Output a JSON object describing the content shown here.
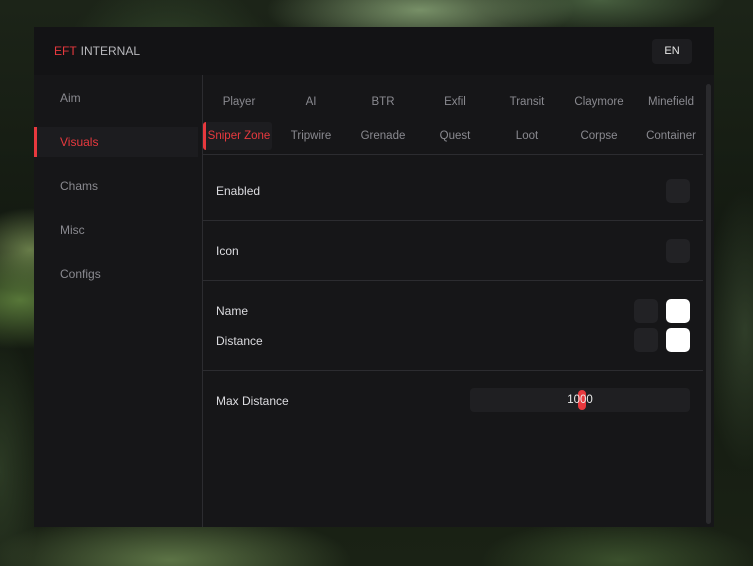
{
  "header": {
    "brand": "EFT",
    "title": "INTERNAL",
    "language": "EN"
  },
  "sidebar": {
    "items": [
      {
        "label": "Aim"
      },
      {
        "label": "Visuals"
      },
      {
        "label": "Chams"
      },
      {
        "label": "Misc"
      },
      {
        "label": "Configs"
      }
    ],
    "active": "Visuals"
  },
  "tabs": {
    "row1": [
      "Player",
      "AI",
      "BTR",
      "Exfil",
      "Transit",
      "Claymore",
      "Minefield"
    ],
    "row2": [
      "Sniper Zone",
      "Tripwire",
      "Grenade",
      "Quest",
      "Loot",
      "Corpse",
      "Container"
    ],
    "active": "Sniper Zone"
  },
  "settings": {
    "enabled_label": "Enabled",
    "icon_label": "Icon",
    "name_label": "Name",
    "distance_label": "Distance",
    "max_distance_label": "Max Distance",
    "max_distance_value": "1000",
    "max_distance_fraction": 0.5
  },
  "colors": {
    "accent": "#e8393e",
    "panel": "#161618",
    "text": "#dcdce0",
    "muted": "#8a8a90"
  }
}
